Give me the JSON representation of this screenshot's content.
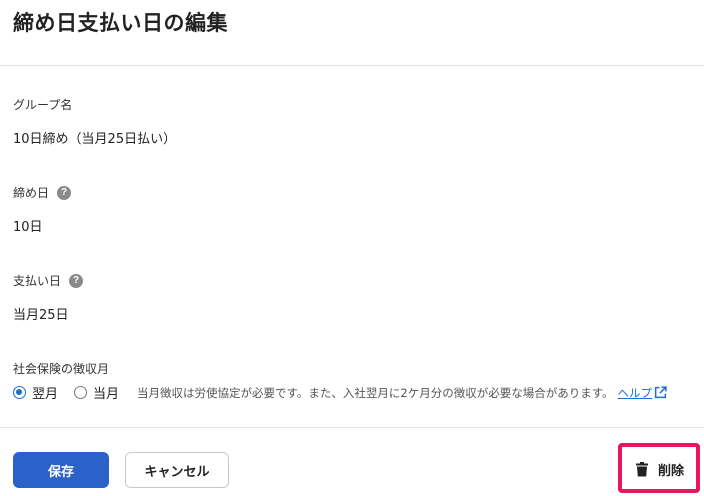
{
  "page": {
    "title": "締め日支払い日の編集"
  },
  "fields": {
    "group_name": {
      "label": "グループ名",
      "value": "10日締め（当月25日払い）"
    },
    "closing_day": {
      "label": "締め日",
      "value": "10日",
      "help": "?"
    },
    "payment_day": {
      "label": "支払い日",
      "value": "当月25日",
      "help": "?"
    }
  },
  "social_insurance": {
    "label": "社会保険の徴収月",
    "options": [
      {
        "label": "翌月",
        "selected": true
      },
      {
        "label": "当月",
        "selected": false
      }
    ],
    "note": "当月徴収は労使協定が必要です。また、入社翌月に2ケ月分の徴収が必要な場合があります。",
    "help_link": "ヘルプ"
  },
  "actions": {
    "save": "保存",
    "cancel": "キャンセル",
    "delete": "削除"
  },
  "colors": {
    "primary": "#2a62c9",
    "link": "#1a6fd6",
    "highlight": "#e8175d"
  },
  "icons": {
    "help": "question-circle-icon",
    "external": "external-link-icon",
    "delete": "trash-icon"
  }
}
